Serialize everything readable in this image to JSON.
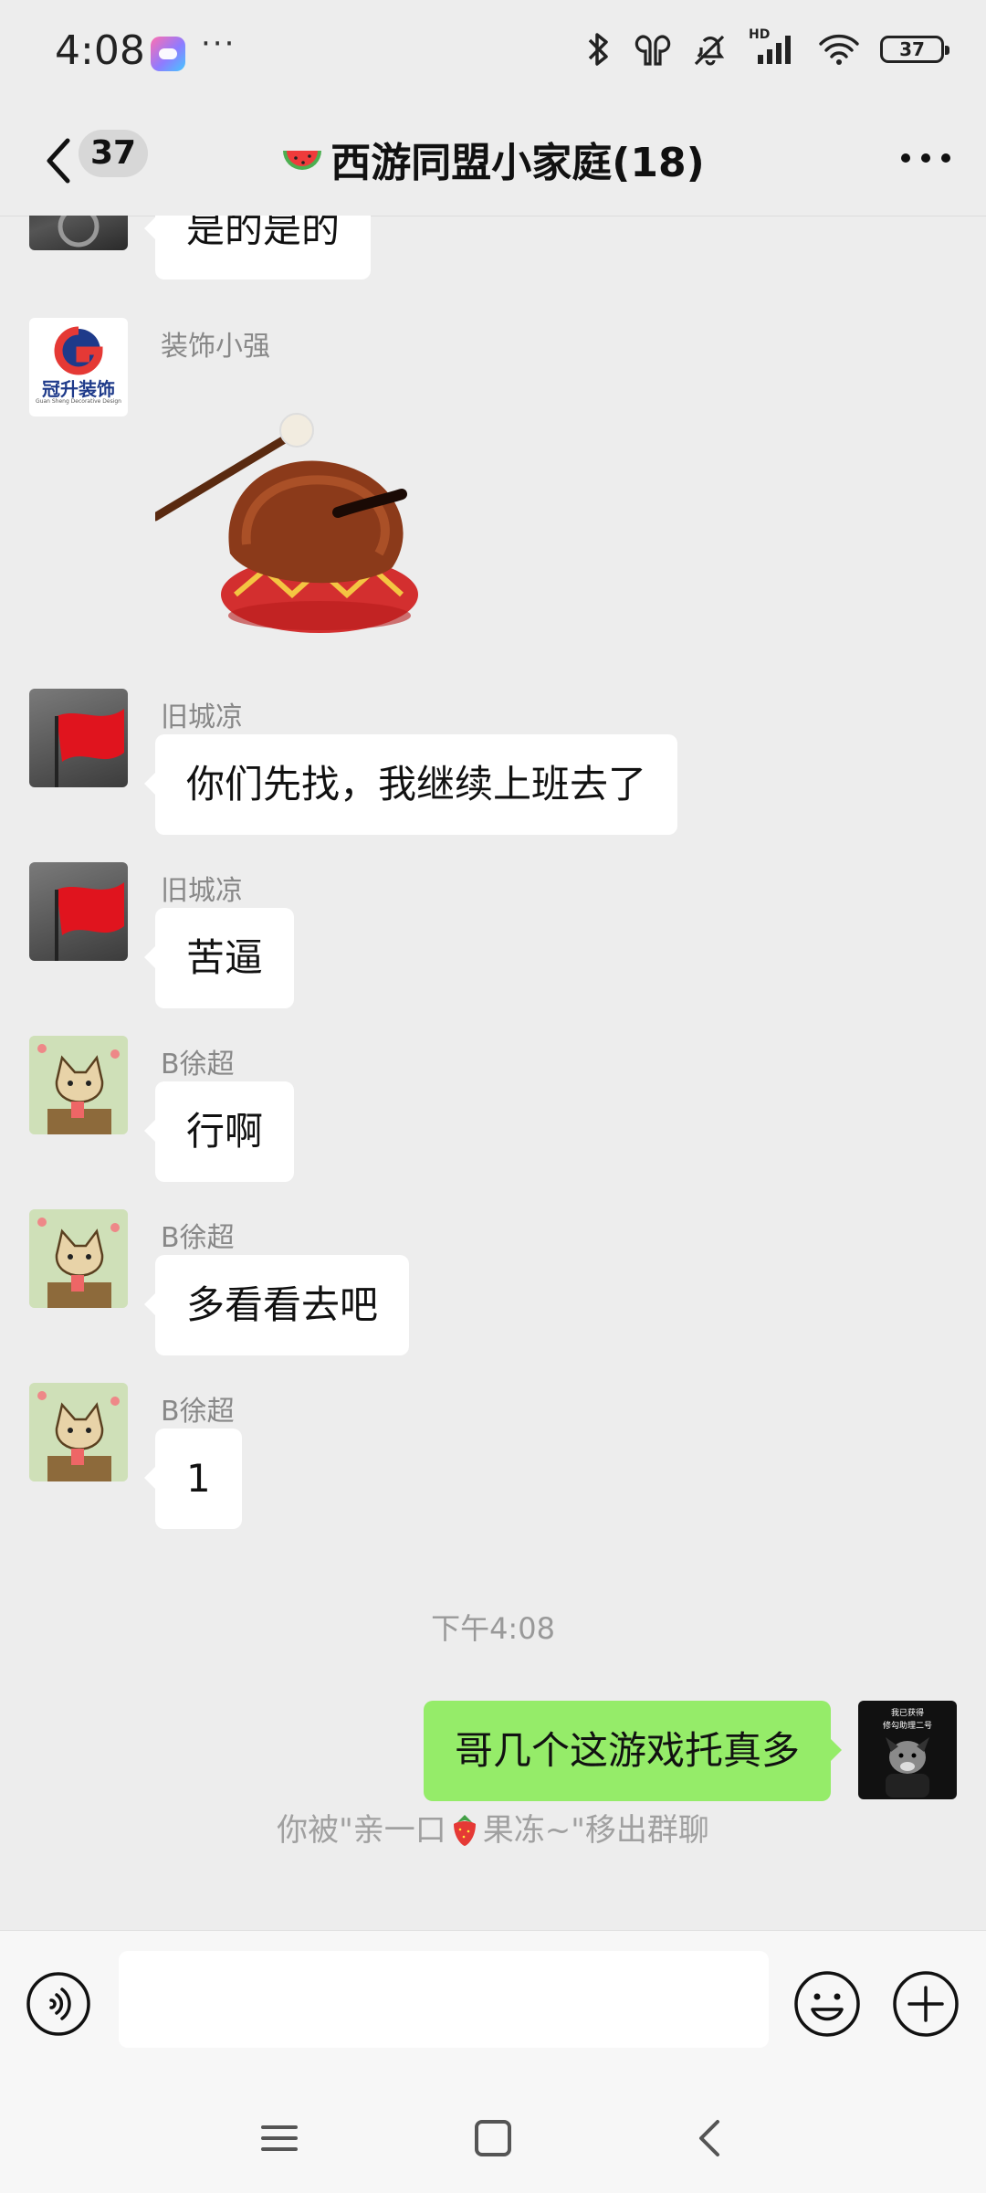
{
  "status": {
    "time": "4:08",
    "more": "···",
    "battery": "37",
    "hd": "HD"
  },
  "header": {
    "unread": "37",
    "title": "西游同盟小家庭(18)"
  },
  "messages": {
    "m0": {
      "text": "是的是的"
    },
    "m1": {
      "sender": "装饰小强",
      "logo_text": "冠升装饰",
      "logo_sub": "Guan Sheng Decorative Design"
    },
    "m2": {
      "sender": "旧城凉",
      "text": "你们先找，我继续上班去了"
    },
    "m3": {
      "sender": "旧城凉",
      "text": "苦逼"
    },
    "m4": {
      "sender": "B徐超",
      "text": "行啊"
    },
    "m5": {
      "sender": "B徐超",
      "text": "多看看去吧"
    },
    "m6": {
      "sender": "B徐超",
      "text": "1"
    },
    "timestamp": "下午4:08",
    "mine": {
      "text": "哥几个这游戏托真多",
      "avatar_text1": "我已获得",
      "avatar_text2": "修勾助理二号"
    },
    "system_before": "你被\"亲一口",
    "system_after": "果冻~\"移出群聊"
  },
  "input": {
    "placeholder": ""
  },
  "colors": {
    "bg": "#ededed",
    "my_bubble": "#95ec69",
    "other_bubble": "#ffffff"
  }
}
